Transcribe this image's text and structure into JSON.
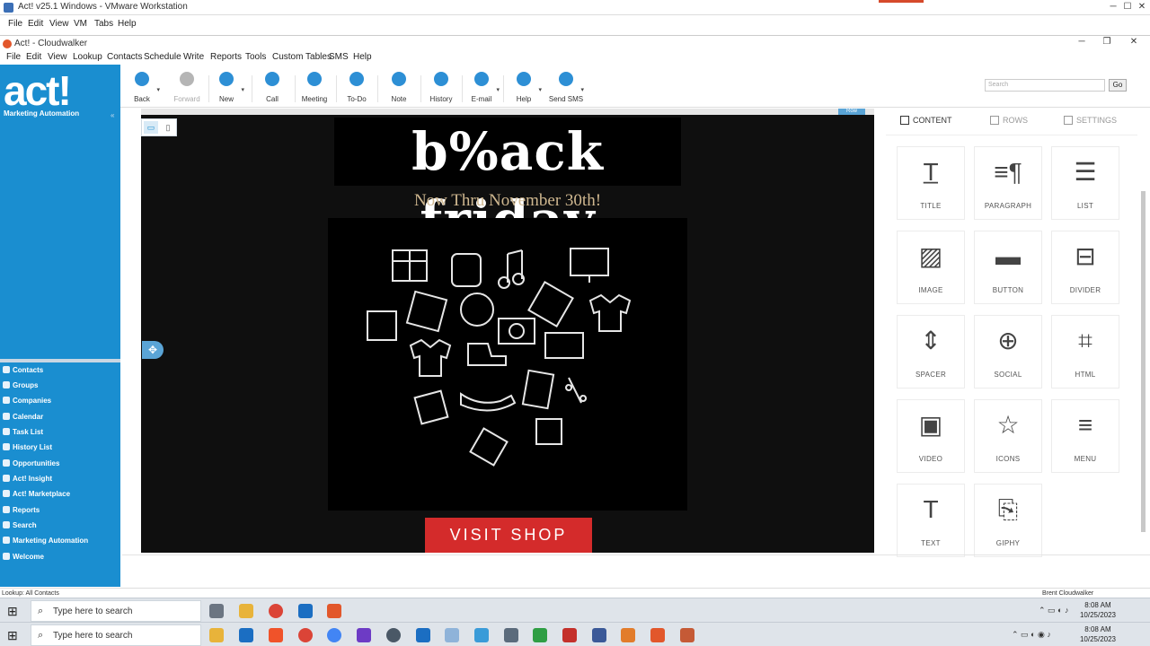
{
  "vm_window": {
    "title": "Act! v25.1 Windows - VMware Workstation",
    "menu": [
      "File",
      "Edit",
      "View",
      "VM",
      "Tabs",
      "Help"
    ]
  },
  "act_window": {
    "title": "Act! - Cloudwalker",
    "menu": [
      "File",
      "Edit",
      "View",
      "Lookup",
      "Contacts",
      "Schedule",
      "Write",
      "Reports",
      "Tools",
      "Custom Tables",
      "SMS",
      "Help"
    ]
  },
  "sidebar": {
    "logo": "act!",
    "subtitle": "Marketing Automation",
    "items": [
      {
        "label": "Contacts"
      },
      {
        "label": "Groups"
      },
      {
        "label": "Companies"
      },
      {
        "label": "Calendar"
      },
      {
        "label": "Task List"
      },
      {
        "label": "History List"
      },
      {
        "label": "Opportunities"
      },
      {
        "label": "Act! Insight"
      },
      {
        "label": "Act! Marketplace"
      },
      {
        "label": "Reports"
      },
      {
        "label": "Search"
      },
      {
        "label": "Marketing Automation"
      },
      {
        "label": "Welcome"
      }
    ]
  },
  "toolbar": {
    "buttons": [
      {
        "label": "Back",
        "icon": "back-arrow-icon",
        "color": "#2d8fd5"
      },
      {
        "label": "Forward",
        "icon": "forward-arrow-icon",
        "color": "#b5b5b5",
        "disabled": true
      },
      {
        "label": "New",
        "icon": "person-icon",
        "color": "#2d8fd5"
      },
      {
        "label": "Call",
        "icon": "phone-icon",
        "color": "#2d8fd5"
      },
      {
        "label": "Meeting",
        "icon": "meeting-icon",
        "color": "#2d8fd5"
      },
      {
        "label": "To-Do",
        "icon": "todo-icon",
        "color": "#2d8fd5"
      },
      {
        "label": "Note",
        "icon": "note-icon",
        "color": "#2d8fd5"
      },
      {
        "label": "History",
        "icon": "history-icon",
        "color": "#2d8fd5"
      },
      {
        "label": "E-mail",
        "icon": "email-icon",
        "color": "#2d8fd5"
      },
      {
        "label": "Help",
        "icon": "help-icon",
        "color": "#2d8fd5"
      },
      {
        "label": "Send SMS",
        "icon": "sms-icon",
        "color": "#2d8fd5"
      }
    ],
    "search_placeholder": "Search",
    "go_label": "Go"
  },
  "editor": {
    "row_tag": "Row",
    "headline": "b%ack friday",
    "subheadline": "Now Thru November 30th!",
    "cta": "VISIT SHOP"
  },
  "content_panel": {
    "tabs": [
      {
        "label": "CONTENT",
        "active": true
      },
      {
        "label": "ROWS",
        "active": false
      },
      {
        "label": "SETTINGS",
        "active": false
      }
    ],
    "blocks": [
      {
        "label": "TITLE",
        "icon": "title-icon"
      },
      {
        "label": "PARAGRAPH",
        "icon": "paragraph-icon"
      },
      {
        "label": "LIST",
        "icon": "list-icon"
      },
      {
        "label": "IMAGE",
        "icon": "image-icon"
      },
      {
        "label": "BUTTON",
        "icon": "button-icon"
      },
      {
        "label": "DIVIDER",
        "icon": "divider-icon"
      },
      {
        "label": "SPACER",
        "icon": "spacer-icon"
      },
      {
        "label": "SOCIAL",
        "icon": "social-icon"
      },
      {
        "label": "HTML",
        "icon": "html-icon"
      },
      {
        "label": "VIDEO",
        "icon": "video-icon"
      },
      {
        "label": "ICONS",
        "icon": "star-icon"
      },
      {
        "label": "MENU",
        "icon": "menu-icon"
      },
      {
        "label": "TEXT",
        "icon": "text-icon"
      },
      {
        "label": "GIPHY",
        "icon": "giphy-icon"
      }
    ]
  },
  "status_bar": {
    "left": "Lookup: All Contacts",
    "right": "Brent Cloudwalker"
  },
  "taskbar": {
    "search_placeholder": "Type here to search",
    "time": "8:08 AM",
    "date": "10/25/2023"
  }
}
